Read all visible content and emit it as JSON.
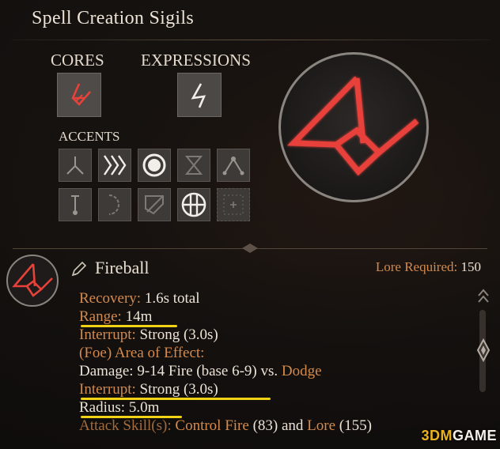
{
  "title": "Spell Creation Sigils",
  "sections": {
    "cores": "CORES",
    "expressions": "EXPRESSIONS",
    "accents": "ACCENTS"
  },
  "accent_icons": [
    "branch-down-icon",
    "triple-chevron-icon",
    "ring-icon",
    "hourglass-icon",
    "triangle-nodes-icon",
    "pillar-icon",
    "half-circle-icon",
    "shield-icon",
    "crosshair-circle-icon",
    "empty-slot-icon"
  ],
  "spell": {
    "name": "Fireball",
    "lore_required_label": "Lore Required:",
    "lore_required_value": "150"
  },
  "details": {
    "recovery_label": "Recovery:",
    "recovery_value": "1.6s total",
    "range_label": "Range:",
    "range_value": "14m",
    "interrupt_label": "Interrupt:",
    "interrupt_value": "Strong (3.0s)",
    "aoe_label": "(Foe) Area of Effect:",
    "damage_text": "Damage: 9-14 Fire (base 6-9) vs.",
    "damage_defense": "Dodge",
    "interrupt2_label": "Interrupt:",
    "interrupt2_value": "Strong (3.0s)",
    "radius_label": "Radius:",
    "radius_value": "5.0m",
    "attack_label": "Attack Skill(s):",
    "attack_skill1": "Control Fire",
    "attack_skill1_val": "(83) and",
    "attack_skill2": "Lore",
    "attack_skill2_val": "(155)"
  },
  "watermark": {
    "logo": "3DM",
    "text": "GAME"
  },
  "colors": {
    "sigil_red": "#e8413a",
    "label_orange": "#d48a4c",
    "highlight_yellow": "#f2d216"
  }
}
